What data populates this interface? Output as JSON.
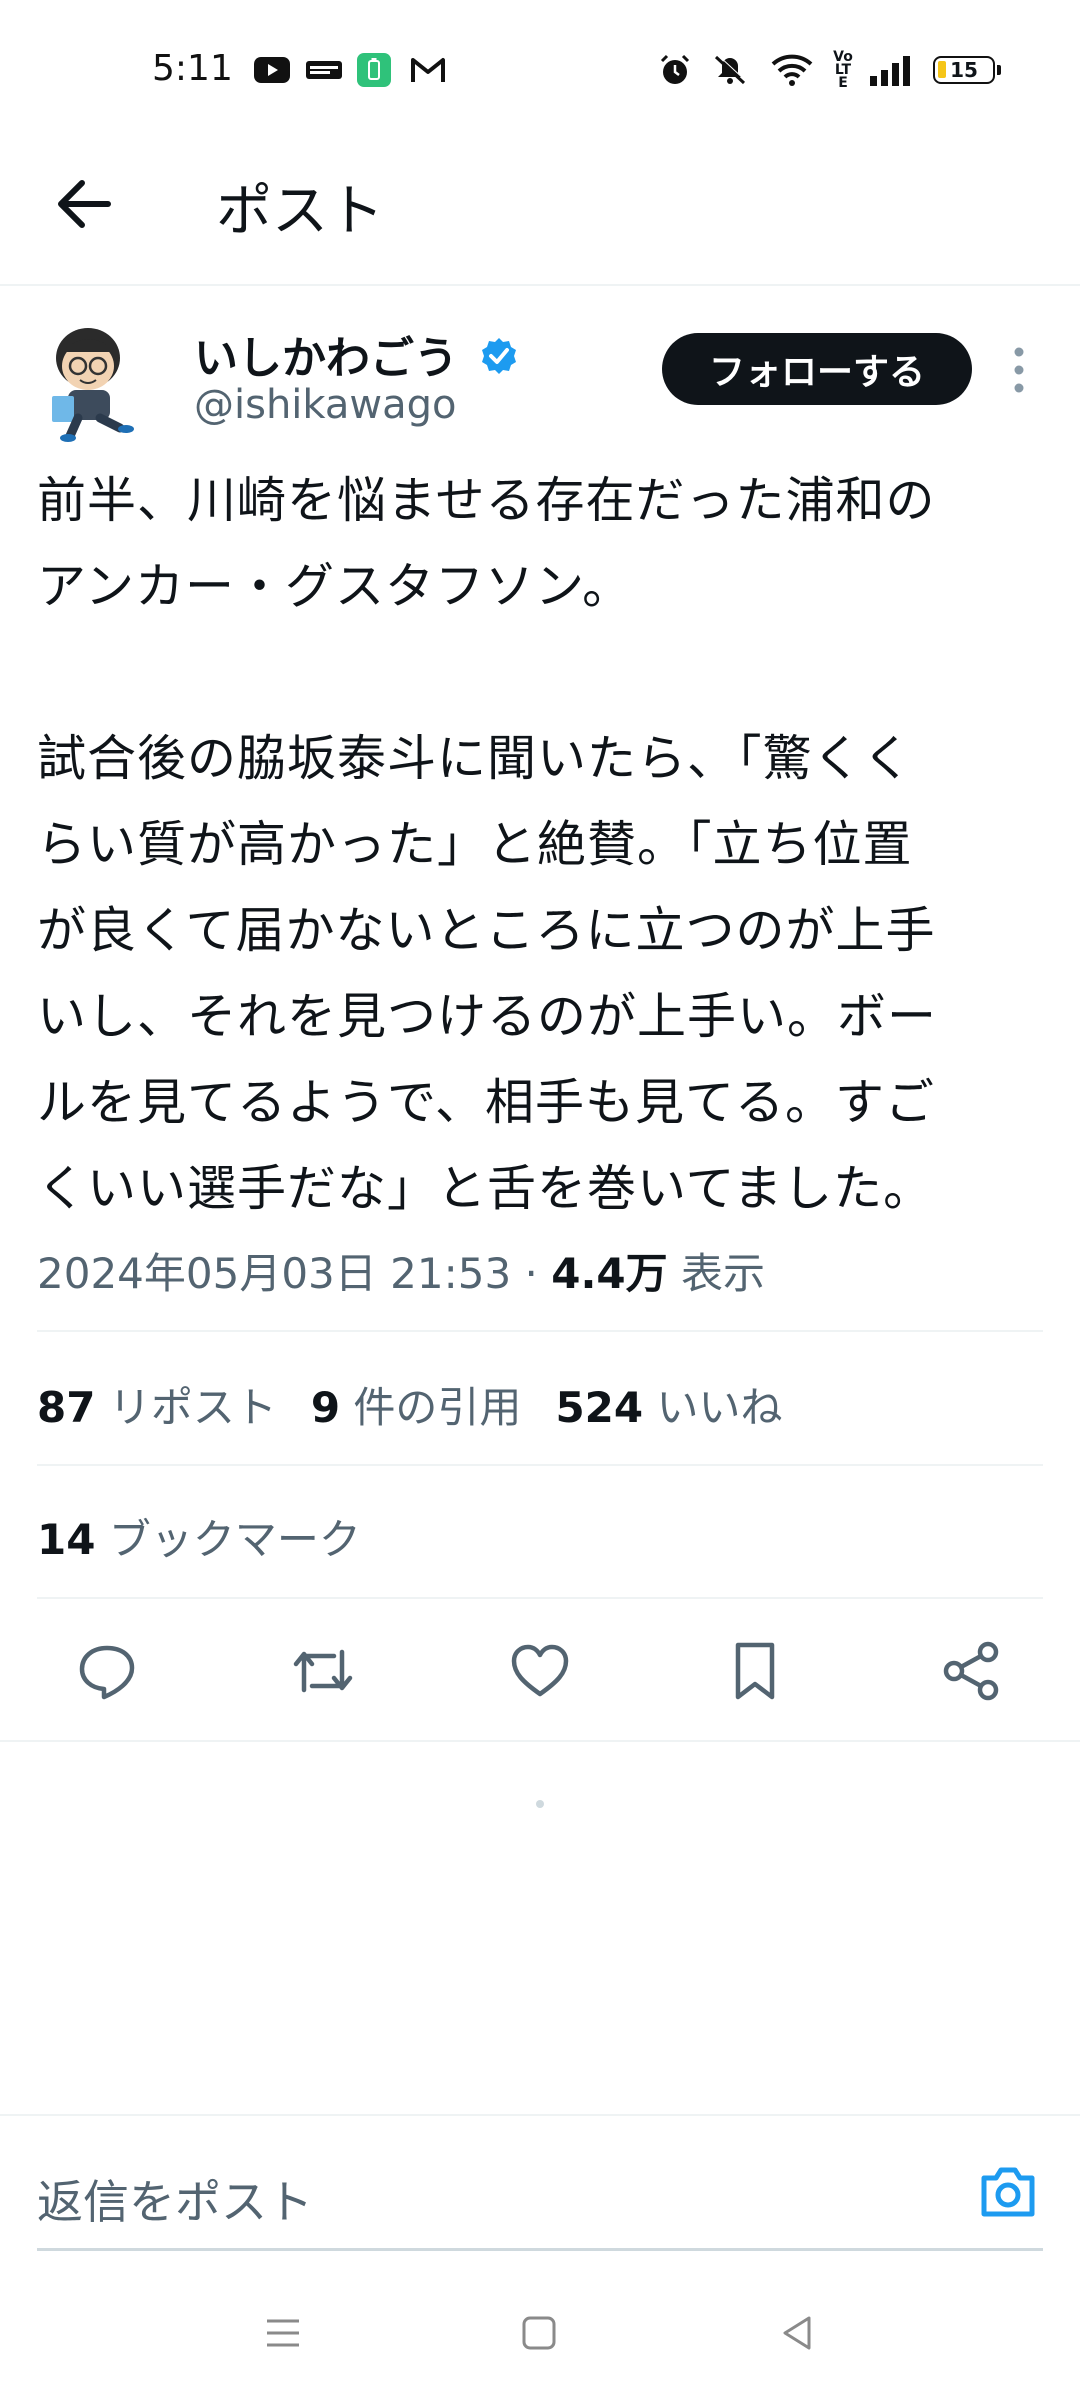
{
  "status_bar": {
    "time": "5:11",
    "battery": "15",
    "network_label": "Vo LTE",
    "icons": [
      "youtube-icon",
      "news-app-icon",
      "battery-saver-icon",
      "gmail-icon",
      "alarm-icon",
      "mute-icon",
      "wifi-icon",
      "volte-icon",
      "signal-icon",
      "battery-icon"
    ]
  },
  "header": {
    "title": "ポスト"
  },
  "author": {
    "display_name": "いしかわごう",
    "handle": "@ishikawago",
    "verified": true,
    "follow_label": "フォローする"
  },
  "tweet": {
    "text": "前半、川崎を悩ませる存在だった浦和の\nアンカー・グスタフソン。\n\n試合後の脇坂泰斗に聞いたら、「驚くく\nらい質が高かった」と絶賛。「立ち位置\nが良くて届かないところに立つのが上手\nいし、それを見つけるのが上手い。ボー\nルを見てるようで、相手も見てる。すご\nくいい選手だな」と舌を巻いてました。",
    "timestamp": "2024年05月03日 21:53",
    "separator": " · ",
    "views_count": "4.4万",
    "views_label": "表示"
  },
  "stats": {
    "reposts_count": "87",
    "reposts_label": "リポスト",
    "quotes_count": "9",
    "quotes_label": "件の引用",
    "likes_count": "524",
    "likes_label": "いいね",
    "bookmarks_count": "14",
    "bookmarks_label": "ブックマーク"
  },
  "actions": [
    "reply-icon",
    "repost-icon",
    "like-icon",
    "bookmark-icon",
    "share-icon"
  ],
  "reply_bar": {
    "placeholder": "返信をポスト"
  },
  "colors": {
    "accent": "#1d9bf0",
    "text": "#0f1419",
    "secondary": "#536471",
    "divider": "#eff3f4",
    "follow_bg": "#0f1419"
  }
}
